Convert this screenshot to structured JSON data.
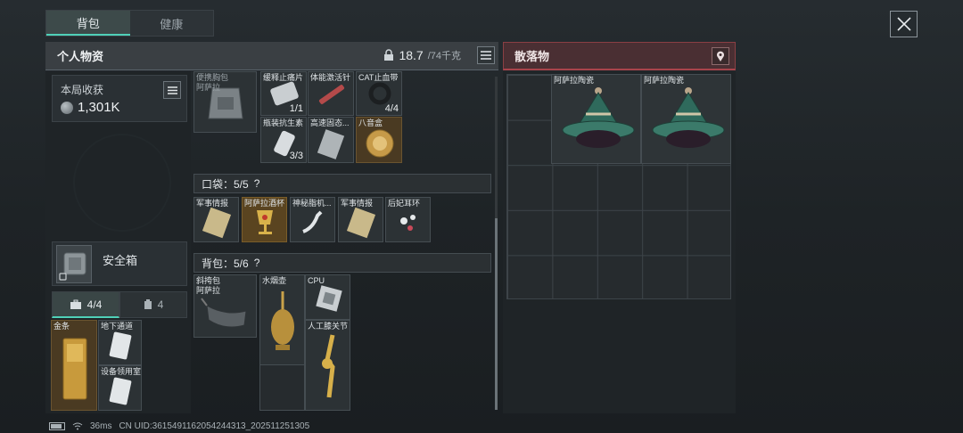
{
  "top_tabs": [
    "背包",
    "健康"
  ],
  "personal": {
    "title": "个人物资",
    "weight_value": "18.7",
    "weight_max": "/74千克"
  },
  "harvest": {
    "label": "本局收获",
    "value": "1,301K"
  },
  "safe_box": {
    "label": "安全箱"
  },
  "sub_tabs": {
    "tab1": "4/4",
    "tab2": "4"
  },
  "secure_items": [
    {
      "name": "金条"
    },
    {
      "name": "地下通道"
    },
    {
      "name": "设备领用室"
    }
  ],
  "equip_top": {
    "name": "便携胸包\n阿萨拉"
  },
  "equip_items": [
    {
      "name": "缓释止痛片",
      "count": "1/1"
    },
    {
      "name": "体能激活针",
      "count": ""
    },
    {
      "name": "CAT止血带",
      "count": "4/4"
    },
    {
      "name": "瓶装抗生素",
      "count": "3/3"
    },
    {
      "name": "高速固态...",
      "count": ""
    },
    {
      "name": "八音盒",
      "count": ""
    }
  ],
  "pocket": {
    "title": "口袋：5/5",
    "help": "?",
    "items": [
      {
        "name": "军事情报"
      },
      {
        "name": "阿萨拉酒杯"
      },
      {
        "name": "神秘脂机..."
      },
      {
        "name": "军事情报"
      },
      {
        "name": "后妃耳环"
      }
    ]
  },
  "backpack": {
    "title": "背包：5/6",
    "help": "?",
    "bag": "斜挎包\n阿萨拉",
    "items": [
      {
        "name": "水烟壶"
      },
      {
        "name": "CPU"
      },
      {
        "name": "人工膝关节"
      }
    ]
  },
  "scatter": {
    "title": "散落物",
    "items": [
      {
        "name": "阿萨拉陶瓷"
      },
      {
        "name": "阿萨拉陶瓷"
      }
    ]
  },
  "status": {
    "ping": "36ms",
    "uid": "CN UID:3615491162054244313_202511251305"
  }
}
